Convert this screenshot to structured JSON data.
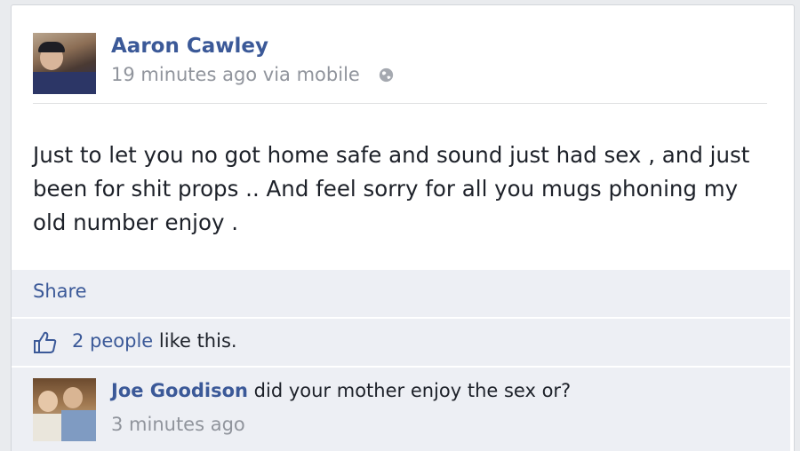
{
  "post": {
    "author": "Aaron Cawley",
    "timestamp": "19 minutes ago via mobile",
    "privacy_icon": "globe-icon",
    "text": "Just to let you no got home safe and sound just had sex , and just been for shit props .. And feel sorry for all you mugs phoning my old number enjoy ."
  },
  "actions": {
    "share_label": "Share"
  },
  "likes": {
    "icon": "thumbs-up-icon",
    "count_text": "2 people",
    "suffix": " like this."
  },
  "comments": [
    {
      "author": "Joe Goodison",
      "text": " did your mother enjoy the sex or?",
      "timestamp": "3 minutes ago"
    }
  ],
  "colors": {
    "link": "#3b5998",
    "footer_bg": "#edeff4",
    "meta_text": "#90949c"
  }
}
